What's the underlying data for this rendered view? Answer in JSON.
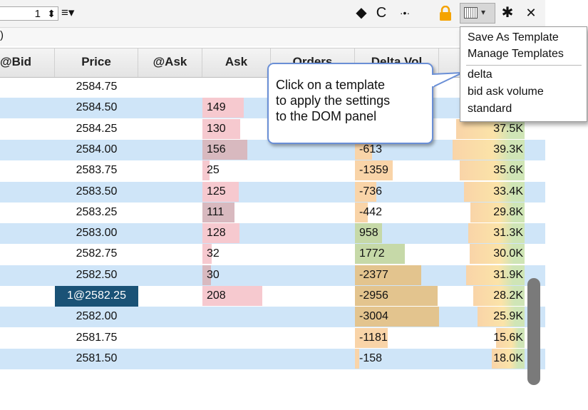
{
  "toolbar": {
    "quantity": "1",
    "spinner_glyph": "⬍",
    "menu_glyph": "≡▾",
    "icons": [
      "eraser-icon",
      "refresh-icon",
      "center-icon",
      "lock-icon",
      "template-icon",
      "gear-icon",
      "close-icon"
    ],
    "eraser_glyph": "◆",
    "refresh_glyph": "C",
    "center_glyph": "·•·",
    "lock_color": "#f5a300",
    "gear_glyph": "✱",
    "close_glyph": "✕",
    "dropdown_arrow": "▾"
  },
  "subbar": {
    "text": ")"
  },
  "columns": [
    "@Bid",
    "Price",
    "@Ask",
    "Ask",
    "Orders",
    "Delta Vol",
    ""
  ],
  "rows": [
    {
      "price": "2584.75",
      "ask": "",
      "ask_bar": 0,
      "delta": "",
      "delta_bar": 0,
      "vol": "",
      "vol_bar": 0
    },
    {
      "price": "2584.50",
      "ask": "149",
      "ask_bar": 0.6,
      "delta": "",
      "delta_bar": 0,
      "vol": "",
      "vol_bar": 0
    },
    {
      "price": "2584.25",
      "ask": "130",
      "ask_bar": 0.55,
      "delta": "",
      "delta_bar": 0.3,
      "vol": "37.5K",
      "vol_bar": 0.8
    },
    {
      "price": "2584.00",
      "ask": "156",
      "ask_bar": 0.66,
      "delta": "-613",
      "delta_bar": 0.2,
      "vol": "39.3K",
      "vol_bar": 0.84
    },
    {
      "price": "2583.75",
      "ask": "25",
      "ask_bar": 0.1,
      "delta": "-1359",
      "delta_bar": 0.45,
      "vol": "35.6K",
      "vol_bar": 0.76
    },
    {
      "price": "2583.50",
      "ask": "125",
      "ask_bar": 0.53,
      "delta": "-736",
      "delta_bar": 0.25,
      "vol": "33.4K",
      "vol_bar": 0.71
    },
    {
      "price": "2583.25",
      "ask": "111",
      "ask_bar": 0.47,
      "delta": "-442",
      "delta_bar": 0.15,
      "vol": "29.8K",
      "vol_bar": 0.63
    },
    {
      "price": "2583.00",
      "ask": "128",
      "ask_bar": 0.54,
      "delta": "958",
      "delta_bar": 0.32,
      "vol": "31.3K",
      "vol_bar": 0.66
    },
    {
      "price": "2582.75",
      "ask": "32",
      "ask_bar": 0.14,
      "delta": "1772",
      "delta_bar": 0.59,
      "vol": "30.0K",
      "vol_bar": 0.64
    },
    {
      "price": "2582.50",
      "ask": "30",
      "ask_bar": 0.13,
      "delta": "-2377",
      "delta_bar": 0.79,
      "vol": "31.9K",
      "vol_bar": 0.68
    },
    {
      "price": "1@2582.25",
      "ask": "208",
      "ask_bar": 0.88,
      "delta": "-2956",
      "delta_bar": 0.98,
      "vol": "28.2K",
      "vol_bar": 0.6
    },
    {
      "price": "2582.00",
      "ask": "",
      "ask_bar": 0,
      "delta": "-3004",
      "delta_bar": 1.0,
      "vol": "25.9K",
      "vol_bar": 0.55
    },
    {
      "price": "2581.75",
      "ask": "",
      "ask_bar": 0,
      "delta": "-1181",
      "delta_bar": 0.39,
      "vol": "15.6K",
      "vol_bar": 0.33
    },
    {
      "price": "2581.50",
      "ask": "",
      "ask_bar": 0,
      "delta": "-158",
      "delta_bar": 0.05,
      "vol": "18.0K",
      "vol_bar": 0.38
    }
  ],
  "dropdown": {
    "items": [
      "Save As Template",
      "Manage Templates"
    ],
    "templates": [
      "delta",
      "bid ask volume",
      "standard"
    ]
  },
  "tooltip": {
    "text": "Click on a template\nto apply the settings\nto the DOM panel"
  },
  "colors": {
    "row_band": "#cfe5f8",
    "ask_bar": "#f6c9cf",
    "ask_bar_alt": "#d8b9bf",
    "delta_pos": "#c6d9a8",
    "delta_neg": "#f9d4a8",
    "delta_neg_dark": "#e3c48e",
    "vol_bar": "#fbe3a8",
    "vol_green": "#cfe5b6",
    "selected_price": "#1a5276"
  }
}
